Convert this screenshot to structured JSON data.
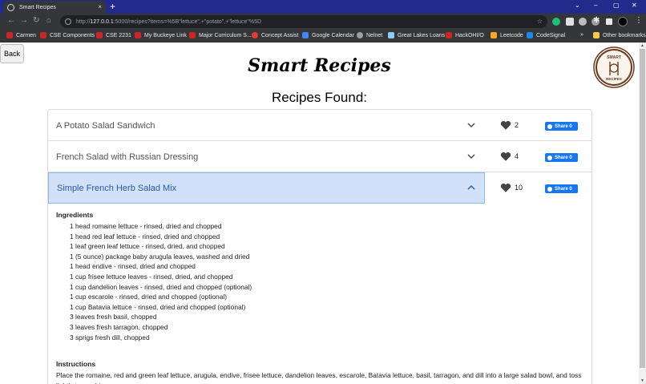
{
  "browser": {
    "tab_title": "Smart Recipes",
    "tab_close": "×",
    "new_tab": "+",
    "window_controls": [
      "⌄",
      "–",
      "▢",
      "✕"
    ],
    "url_host": "127.0.0.1",
    "url_prefix": "http://",
    "url_rest": ":5000/recipes?items=%5B\"lettuce\",+\"potato\",+\"lettuce\"%5D",
    "bookmarks": [
      {
        "label": "Carmen",
        "color": "#c62828"
      },
      {
        "label": "CSE Components",
        "color": "#c62828"
      },
      {
        "label": "CSE 2231",
        "color": "#c62828"
      },
      {
        "label": "My Buckeye Link",
        "color": "#c62828"
      },
      {
        "label": "Major Curriculum S...",
        "color": "#c62828"
      },
      {
        "label": "Concept Assist",
        "color": "#e53935"
      },
      {
        "label": "Google Calendar",
        "color": "#4285f4"
      },
      {
        "label": "Nelnet",
        "color": "#9e9e9e"
      },
      {
        "label": "Great Lakes Loans",
        "color": "#90caf9"
      },
      {
        "label": "HackOHI/O",
        "color": "#c62828"
      },
      {
        "label": "Leetcode",
        "color": "#f9a825"
      },
      {
        "label": "CodeSignal",
        "color": "#1e88e5"
      }
    ],
    "more_bookmarks": "»",
    "other_bookmarks": "Other bookmarks"
  },
  "page": {
    "back_label": "Back",
    "app_title": "Smart Recipes",
    "heading": "Recipes Found:",
    "logo_text_top": "SMART",
    "logo_text_bottom": "RECIPES",
    "share_label": "Share 0",
    "recipes": [
      {
        "title": "A Potato Salad Sandwich",
        "likes": "2",
        "expanded": false
      },
      {
        "title": "French Salad with Russian Dressing",
        "likes": "4",
        "expanded": false
      },
      {
        "title": "Simple French Herb Salad Mix",
        "likes": "10",
        "expanded": true
      }
    ],
    "ingredients_heading": "Ingredients",
    "ingredients": [
      "1 head romaine lettuce - rinsed, dried and chopped",
      "1 head red leaf lettuce - rinsed, dried and chopped",
      "1 leaf green leaf lettuce - rinsed, dried, and chopped",
      "1 (5 ounce) package baby arugula leaves, washed and dried",
      "1 head endive - rinsed, dried and chopped",
      "1 cup frisee lettuce leaves - rinsed, dried, and chopped",
      "1 cup dandelion leaves - rinsed, dried and chopped (optional)",
      "1 cup escarole - rinsed, dried and chopped (optional)",
      "1 cup Batavia lettuce - rinsed, dried and chopped (optional)",
      "3 leaves fresh basil, chopped",
      "3 leaves fresh tarragon, chopped",
      "3 sprigs fresh dill, chopped"
    ],
    "instructions_heading": "Instructions",
    "instructions": "Place the romaine, red and green leaf lettuce, arugula, endive, frisee lettuce, dandelion leaves, escarole, Batavia lettuce, basil, tarragon, and dill into a large salad bowl, and toss lightly to combine."
  },
  "colors": {
    "accent": "#1877f2",
    "active_row": "#d0e1f9",
    "active_text": "#2c56a0"
  }
}
